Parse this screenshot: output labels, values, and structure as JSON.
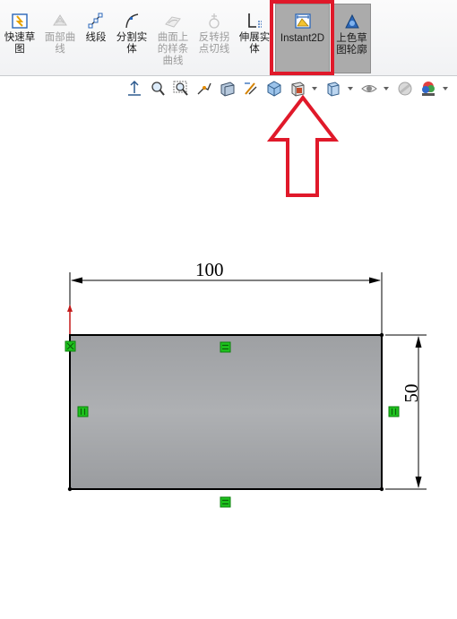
{
  "ribbon": {
    "buttons": [
      {
        "id": "quick-sketch",
        "label": "快速草\n图",
        "enabled": true,
        "icon": "quick-sketch-icon"
      },
      {
        "id": "face-curves",
        "label": "面部曲\n线",
        "enabled": false,
        "icon": "face-curves-icon"
      },
      {
        "id": "segment",
        "label": "线段",
        "enabled": true,
        "icon": "segment-icon"
      },
      {
        "id": "split-entities",
        "label": "分割实\n体",
        "enabled": true,
        "icon": "split-entities-icon"
      },
      {
        "id": "spline-on-surface",
        "label": "曲面上\n的样条\n曲线",
        "enabled": false,
        "icon": "spline-on-surface-icon"
      },
      {
        "id": "inflection-points",
        "label": "反转拐\n点切线",
        "enabled": false,
        "icon": "inflection-icon"
      },
      {
        "id": "extend-entities",
        "label": "伸展实\n体",
        "enabled": true,
        "icon": "extend-entities-icon"
      },
      {
        "id": "instant2d",
        "label": "Instant2D",
        "enabled": true,
        "pressed": true,
        "icon": "instant2d-icon"
      },
      {
        "id": "shaded-sketch-contours",
        "label": "上色草\n图轮廓",
        "enabled": true,
        "pressed": true,
        "icon": "shaded-contours-icon"
      }
    ]
  },
  "view_toolbar": {
    "icons": [
      "view-orientation-icon",
      "zoom-to-fit-icon",
      "zoom-to-area-icon",
      "previous-view-icon",
      "section-view-icon",
      "dynamic-annotation-icon",
      "view-cube-icon",
      "display-style-icon",
      "hide-show-icon",
      "appearance-icon",
      "scenes-icon"
    ]
  },
  "sketch": {
    "dimension_horizontal": "100",
    "dimension_vertical": "50",
    "rectangle_fill": "#a4a6a9",
    "relation_color": "#1ec31e",
    "origin_color": "#c41a1a"
  },
  "annotation": {
    "color": "#e0192a"
  }
}
